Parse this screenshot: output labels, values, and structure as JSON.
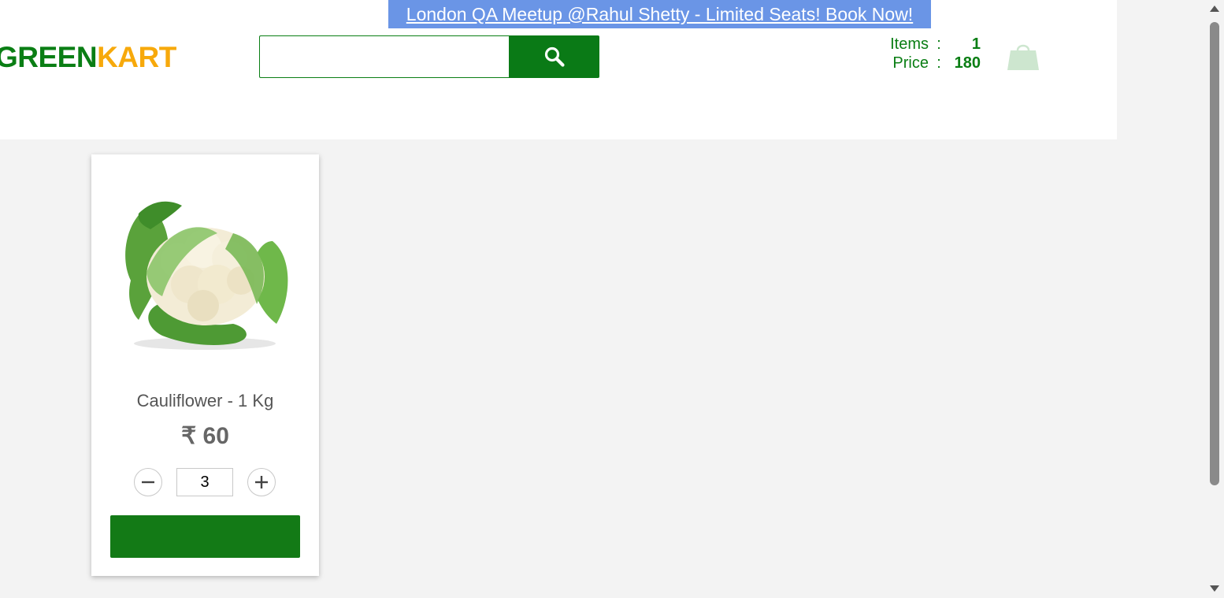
{
  "promo": {
    "text": "London QA Meetup @Rahul Shetty - Limited Seats! Book Now!"
  },
  "brand": {
    "part1": "GREEN",
    "part2": "KART",
    "color1": "#0a7e14",
    "color2": "#f7a90b"
  },
  "search": {
    "value": "",
    "placeholder": "",
    "button_icon": "search-icon"
  },
  "cart_info": {
    "items_label": "Items",
    "items_value": "1",
    "price_label": "Price",
    "price_value": "180",
    "separator": ":",
    "icon": "shopping-bag-icon"
  },
  "product": {
    "name": "Cauliflower - 1 Kg",
    "price": "₹ 60",
    "quantity": "3",
    "image": "cauliflower-image",
    "add_button_label": ""
  },
  "colors": {
    "accent": "#0a7a16",
    "promo_bg": "#6a95e6"
  }
}
